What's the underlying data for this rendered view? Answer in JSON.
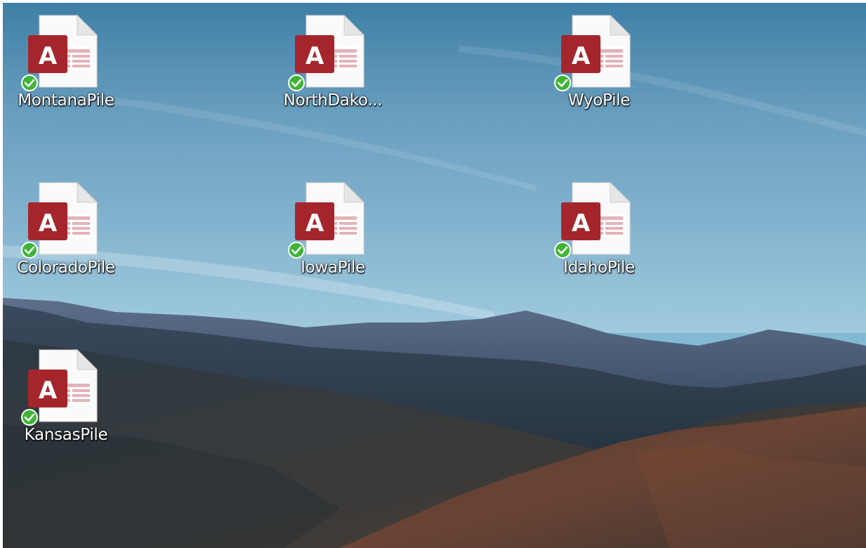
{
  "desktop": {
    "icons": [
      {
        "label": "MontanaPile",
        "icon": "access-database-icon",
        "status": "synced-check-icon"
      },
      {
        "label": "NorthDako...",
        "icon": "access-database-icon",
        "status": "synced-check-icon"
      },
      {
        "label": "WyoPile",
        "icon": "access-database-icon",
        "status": "synced-check-icon"
      },
      {
        "label": "ColoradoPile",
        "icon": "access-database-icon",
        "status": "synced-check-icon"
      },
      {
        "label": "IowaPile",
        "icon": "access-database-icon",
        "status": "synced-check-icon"
      },
      {
        "label": "IdahoPile",
        "icon": "access-database-icon",
        "status": "synced-check-icon"
      },
      {
        "label": "KansasPile",
        "icon": "access-database-icon",
        "status": "synced-check-icon"
      }
    ],
    "colors": {
      "access_red": "#a4262c",
      "sync_green": "#3fb535",
      "label_text": "#ffffff"
    }
  }
}
